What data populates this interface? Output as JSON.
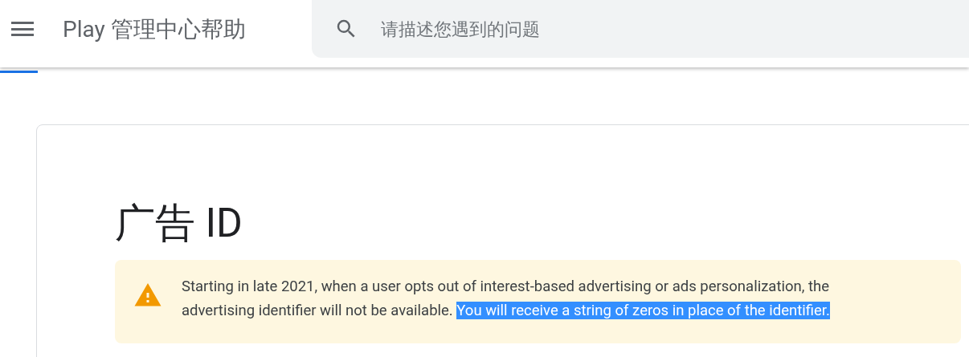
{
  "header": {
    "title": "Play 管理中心帮助",
    "search": {
      "placeholder": "请描述您遇到的问题"
    }
  },
  "article": {
    "title": "广告 ID",
    "notice": {
      "segments": [
        {
          "text": "Starting in late 2021, when a user opts out of interest-based advertising or ads personalization, the advertising identifier will not be available. ",
          "selected": false
        },
        {
          "text": "You will receive a string of zeros in place of the identifier.",
          "selected": true
        }
      ]
    }
  }
}
